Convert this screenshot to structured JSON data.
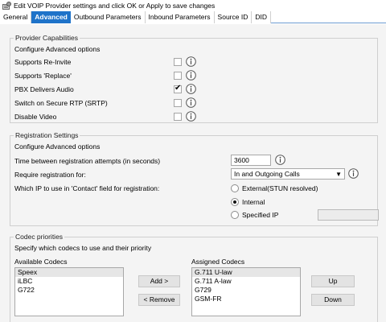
{
  "window": {
    "title": "Edit VOIP Provider settings and click OK or Apply to save changes",
    "icon": "phone-settings-icon"
  },
  "tabs": [
    {
      "label": "General",
      "active": false
    },
    {
      "label": "Advanced",
      "active": true
    },
    {
      "label": "Outbound Parameters",
      "active": false
    },
    {
      "label": "Inbound Parameters",
      "active": false
    },
    {
      "label": "Source ID",
      "active": false
    },
    {
      "label": "DID",
      "active": false
    }
  ],
  "provider_capabilities": {
    "legend": "Provider Capabilities",
    "subtitle": "Configure Advanced options",
    "options": [
      {
        "label": "Supports Re-Invite",
        "checked": false
      },
      {
        "label": "Supports 'Replace'",
        "checked": false
      },
      {
        "label": "PBX Delivers Audio",
        "checked": true
      },
      {
        "label": "Switch on Secure RTP (SRTP)",
        "checked": false
      },
      {
        "label": "Disable Video",
        "checked": false
      }
    ]
  },
  "registration": {
    "legend": "Registration Settings",
    "subtitle": "Configure Advanced options",
    "time_label": "Time between registration attempts (in seconds)",
    "time_value": "3600",
    "require_label": "Require registration for:",
    "require_value": "In and Outgoing Calls",
    "contact_label": "Which IP to use in 'Contact' field for registration:",
    "contact_options": [
      {
        "label": "External(STUN resolved)",
        "selected": false
      },
      {
        "label": "Internal",
        "selected": true
      },
      {
        "label": "Specified IP",
        "selected": false
      }
    ],
    "specified_ip_value": ""
  },
  "codecs": {
    "legend": "Codec priorities",
    "subtitle": "Specify which codecs to use and their priority",
    "available_label": "Available Codecs",
    "available": [
      "Speex",
      "iLBC",
      "G722"
    ],
    "assigned_label": "Assigned Codecs",
    "assigned": [
      "G.711 U-law",
      "G.711 A-law",
      "G729",
      "GSM-FR"
    ],
    "add_label": "Add  >",
    "remove_label": "<  Remove",
    "up_label": "Up",
    "down_label": "Down"
  }
}
